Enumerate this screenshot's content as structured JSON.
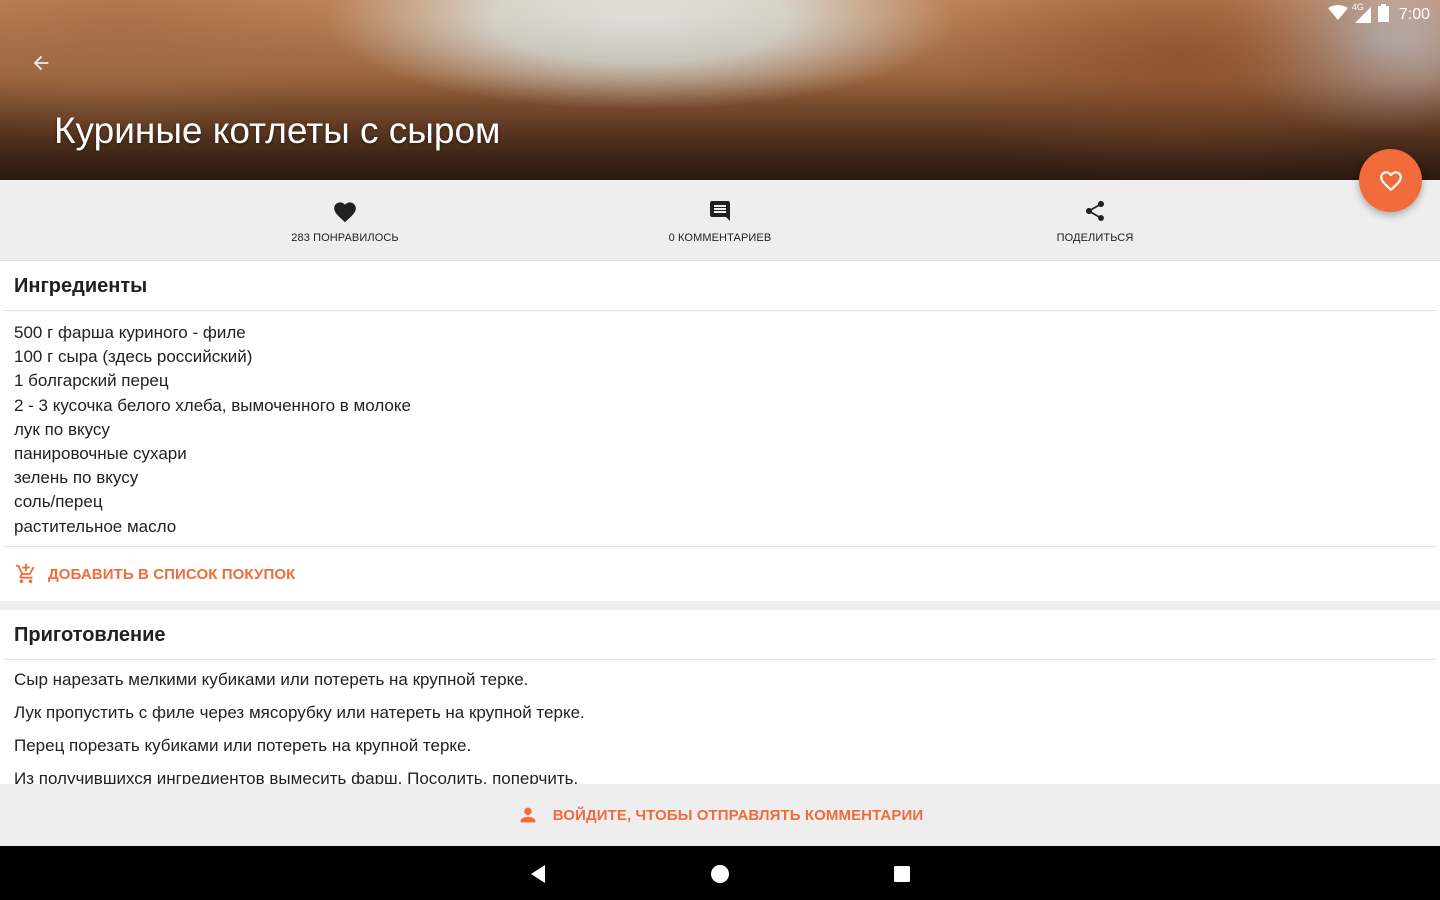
{
  "status_bar": {
    "time": "7:00",
    "network": "4G",
    "icons": [
      "wifi-icon",
      "cell-signal-icon",
      "battery-icon"
    ]
  },
  "header": {
    "title": "Куриные котлеты с сыром",
    "back_icon": "arrow-left-icon"
  },
  "fab": {
    "icon": "heart-outline-icon"
  },
  "actions": {
    "likes": {
      "label": "283 ПОНРАВИЛОСЬ",
      "icon": "heart-icon"
    },
    "comments": {
      "label": "0 КОММЕНТАРИЕВ",
      "icon": "comment-icon"
    },
    "share": {
      "label": "ПОДЕЛИТЬСЯ",
      "icon": "share-icon"
    }
  },
  "ingredients": {
    "title": "Ингредиенты",
    "items": [
      "500 г фарша куриного - филе",
      "100 г сыра (здесь российский)",
      "1 болгарский перец",
      "2 - 3 кусочка белого хлеба, вымоченного в молоке",
      "лук по вкусу",
      "панировочные сухари",
      "зелень по вкусу",
      "соль/перец",
      "растительное масло"
    ],
    "add_to_shopping": {
      "label": "ДОБАВИТЬ В СПИСОК ПОКУПОК",
      "icon": "add-to-cart-icon"
    }
  },
  "preparation": {
    "title": "Приготовление",
    "steps": [
      "Сыр нарезать мелкими кубиками или потереть на крупной терке.",
      "Лук пропустить с филе через мясорубку или натереть на крупной терке.",
      "Перец порезать кубиками или потереть на крупной терке.",
      "Из получившихся ингредиентов вымесить фарш. Посолить, поперчить."
    ]
  },
  "login_bar": {
    "label": "ВОЙДИТЕ, ЧТОБЫ ОТПРАВЛЯТЬ КОММЕНТАРИИ",
    "icon": "person-icon"
  },
  "nav_bar": {
    "icons": [
      "back-triangle-icon",
      "home-circle-icon",
      "recents-square-icon"
    ]
  },
  "colors": {
    "accent": "#f26b3a",
    "bar_background": "#eeeeee",
    "text": "#212121"
  }
}
